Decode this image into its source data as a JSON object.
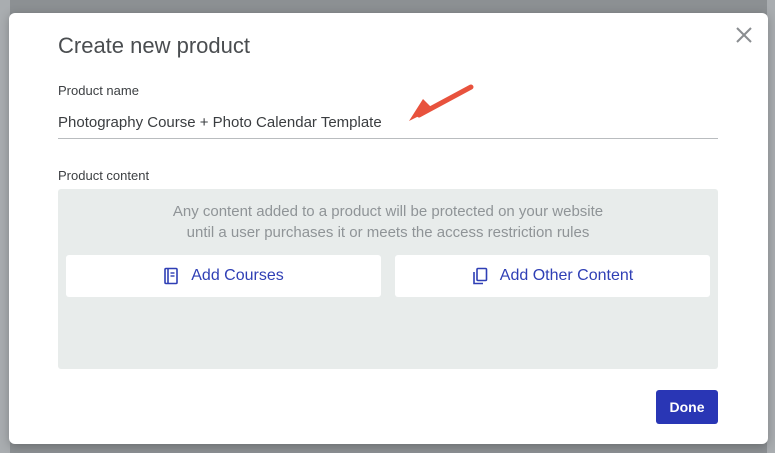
{
  "modal": {
    "title": "Create new product",
    "close_icon": "close-icon",
    "product_name_label": "Product name",
    "product_name_value": "Photography Course + Photo Calendar Template",
    "product_content_label": "Product content",
    "content_hint_line1": "Any content added to a product will be protected on your website",
    "content_hint_line2": "until a user purchases it or meets the access restriction rules",
    "add_courses_label": "Add Courses",
    "add_courses_icon": "book-icon",
    "add_other_label": "Add Other Content",
    "add_other_icon": "copy-icon",
    "done_label": "Done"
  },
  "colors": {
    "accent": "#2936b5",
    "link": "#2f3fb5",
    "annotation_arrow": "#e8523d",
    "content_bg": "#e8eceb"
  }
}
